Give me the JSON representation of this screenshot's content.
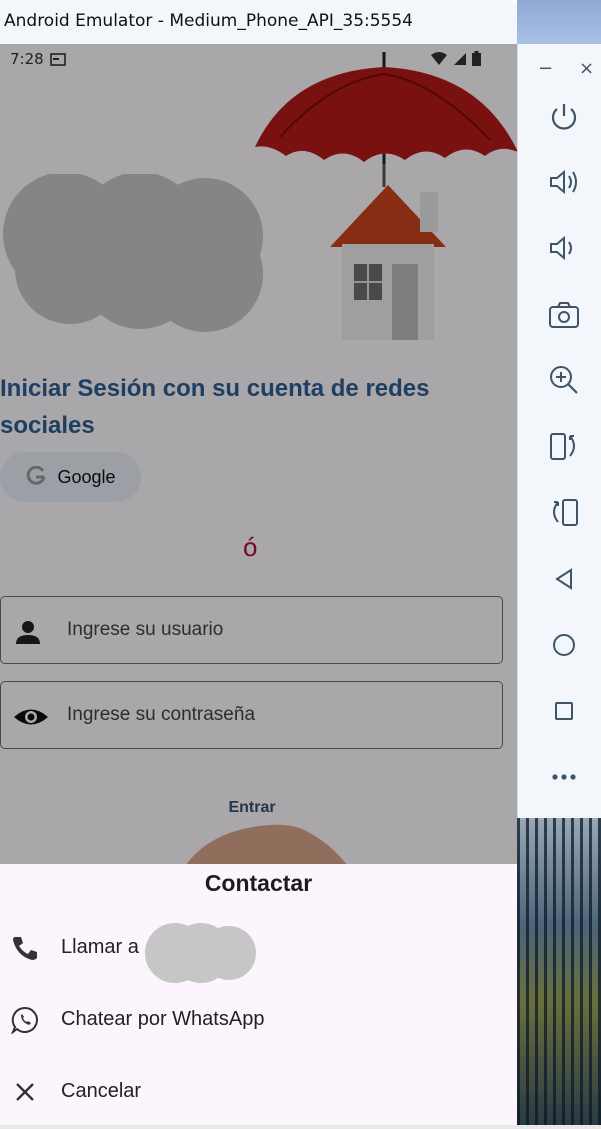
{
  "window": {
    "title": "Android Emulator - Medium_Phone_API_35:5554"
  },
  "status_bar": {
    "time": "7:28"
  },
  "login": {
    "social_heading": "Iniciar Sesión con su cuenta de redes sociales",
    "google_label": "Google",
    "accent_char": "ó",
    "username_placeholder": "Ingrese su usuario",
    "password_placeholder": "Ingrese su contraseña",
    "enter_label": "Entrar"
  },
  "sheet": {
    "title": "Contactar",
    "items": [
      {
        "label": "Llamar a",
        "icon": "phone-icon"
      },
      {
        "label": "Chatear por WhatsApp",
        "icon": "whatsapp-icon"
      },
      {
        "label": "Cancelar",
        "icon": "close-icon"
      }
    ]
  },
  "toolbar": {
    "minimize": "−",
    "close": "×",
    "buttons": [
      "power-icon",
      "volume-up-icon",
      "volume-down-icon",
      "camera-icon",
      "zoom-icon",
      "rotate-left-icon",
      "rotate-right-icon",
      "back-icon",
      "home-icon",
      "overview-icon",
      "more-icon"
    ]
  },
  "colors": {
    "accent": "#2f5f92",
    "sheet_bg": "#fdf5fd",
    "umbrella": "#b51a1a"
  }
}
